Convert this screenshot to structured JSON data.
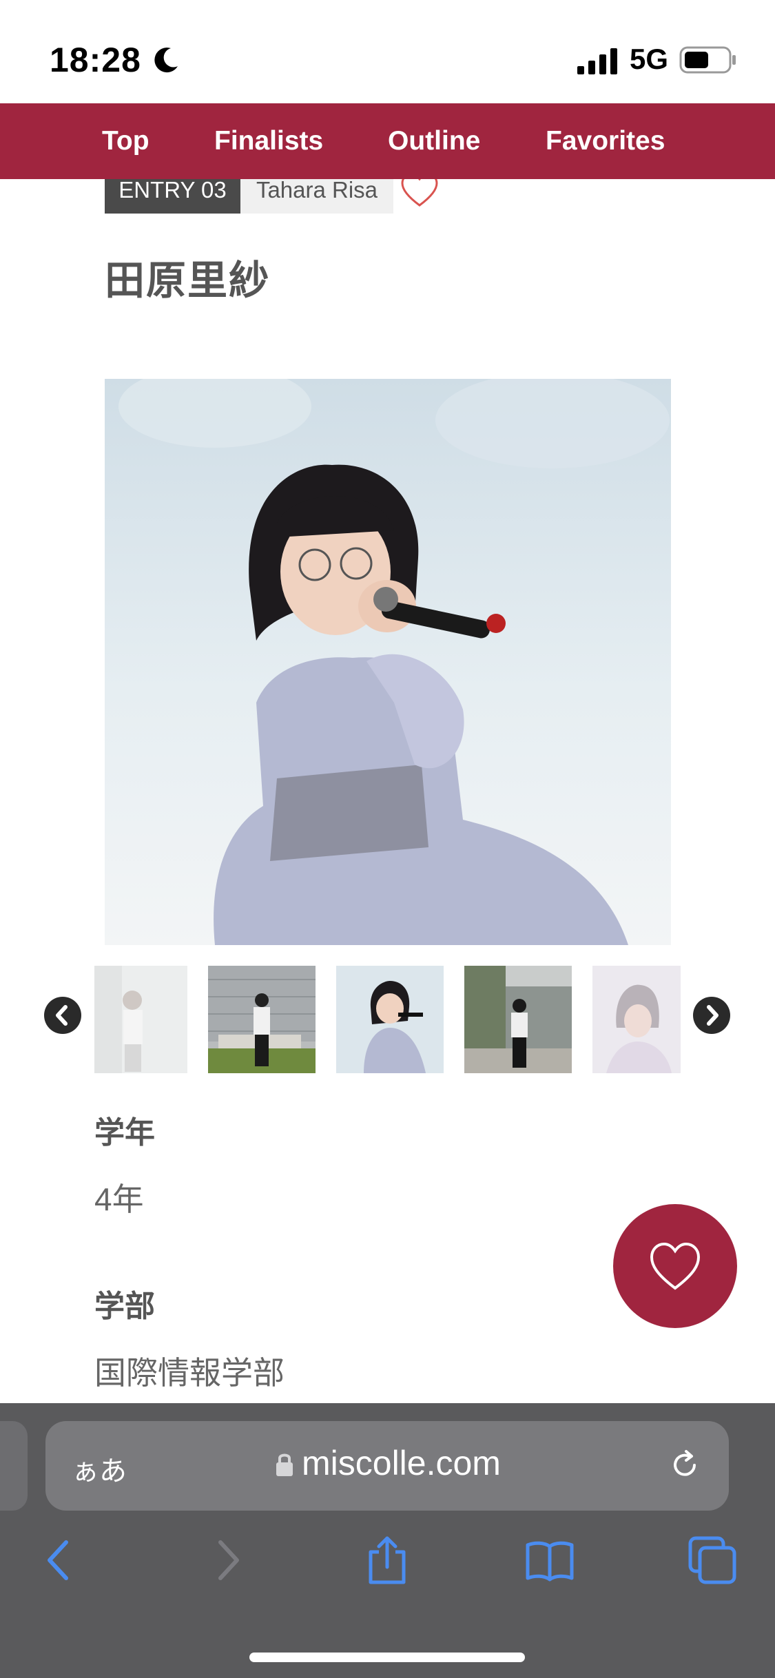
{
  "status_bar": {
    "time": "18:28",
    "network": "5G"
  },
  "nav": {
    "items": [
      "Top",
      "Finalists",
      "Outline",
      "Favorites"
    ]
  },
  "entry": {
    "badge": "ENTRY 03",
    "romaji": "Tahara Risa",
    "name": "田原里紗"
  },
  "profile": [
    {
      "label": "学年",
      "value": "4年"
    },
    {
      "label": "学部",
      "value": "国際情報学部"
    }
  ],
  "browser": {
    "aa_label": "ぁあ",
    "url": "miscolle.com"
  },
  "colors": {
    "brand": "#a0253f",
    "toolbar_icon": "#4a8cf0",
    "toolbar_bg": "#5a5a5c"
  },
  "icons": [
    "moon-icon",
    "signal-icon",
    "battery-icon",
    "heart-outline-icon",
    "chevron-left-icon",
    "chevron-right-icon",
    "lock-icon",
    "reload-icon",
    "back-icon",
    "forward-icon",
    "share-icon",
    "bookmarks-icon",
    "tabs-icon"
  ]
}
